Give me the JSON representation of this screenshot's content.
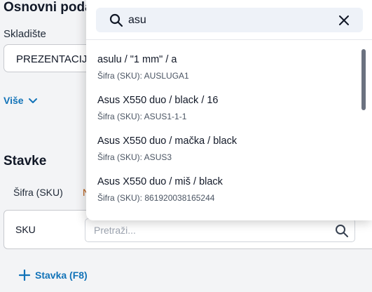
{
  "page": {
    "section_title": "Osnovni podaci",
    "warehouse_label": "Skladište",
    "warehouse_value": "PREZENTACIJA",
    "more_label": "Više",
    "items_title": "Stavke",
    "columns": [
      "Šifra (SKU)",
      "N"
    ],
    "sku_row_label": "SKU",
    "sku_search_placeholder": "Pretraži...",
    "add_item_label": "Stavka (F8)"
  },
  "dropdown": {
    "search_value": "asu",
    "results": [
      {
        "name": "asulu / \"1 mm\" / a",
        "sku": "Šifra (SKU): AUSLUGA1"
      },
      {
        "name": "Asus X550 duo / black / 16",
        "sku": "Šifra (SKU): ASUS1-1-1"
      },
      {
        "name": "Asus X550 duo / mačka / black",
        "sku": "Šifra (SKU): ASUS3"
      },
      {
        "name": "Asus X550 duo / miš / black",
        "sku": "Šifra (SKU): 861920038165244"
      }
    ]
  },
  "icons": {
    "search": "search-icon",
    "close": "close-icon",
    "chevron": "chevron-down-icon",
    "plus": "plus-icon"
  },
  "colors": {
    "accent": "#1273b8",
    "background": "#f3f4f6",
    "search_bg": "#eef2f8"
  }
}
